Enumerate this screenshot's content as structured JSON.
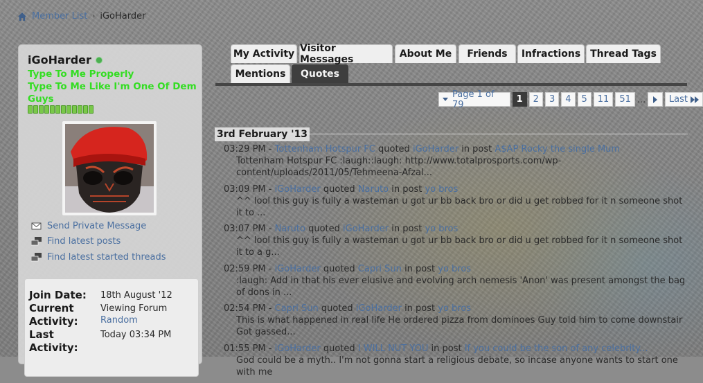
{
  "breadcrumb": {
    "items": [
      "Member List"
    ],
    "current": "iGoHarder"
  },
  "profile": {
    "username": "iGoHarder",
    "title_lines": [
      "Type To Me Properly",
      "Type To Me Like I'm One Of Dem Guys"
    ],
    "links": [
      "Send Private Message",
      "Find latest posts",
      "Find latest started threads"
    ],
    "info": {
      "join_label": "Join Date:",
      "join_value": "18th August '12",
      "current_label_1": "Current",
      "current_label_2": "Activity:",
      "current_value": "Viewing Forum",
      "current_link": "Random",
      "last_label_1": "Last",
      "last_label_2": "Activity:",
      "last_value": "Today 03:34 PM"
    }
  },
  "tabs": [
    "My Activity",
    "Visitor Messages",
    "About Me",
    "Friends",
    "Infractions",
    "Thread Tags",
    "Mentions",
    "Quotes"
  ],
  "active_tab": "Quotes",
  "pagination": {
    "page_of": "Page 1 of 79",
    "current": "1",
    "pages": [
      "2",
      "3",
      "4",
      "5",
      "11",
      "51"
    ],
    "dots": "...",
    "last": "Last"
  },
  "date_header": "3rd February '13",
  "activity": [
    {
      "time": "03:29 PM",
      "user": "Tottenham Hotspur FC",
      "verb": "quoted",
      "target": "iGoHarder",
      "in": "in post",
      "post": "A$AP Rocky the single Mum",
      "body": "Tottenham Hotspur FC :laugh::laugh: http://www.totalprosports.com/wp-content/uploads/2011/05/Tehmeena-Afzal..."
    },
    {
      "time": "03:09 PM",
      "user": "iGoHarder",
      "verb": "quoted",
      "target": "Naruto",
      "in": "in post",
      "post": "yo bros",
      "body": "^^ lool this guy is fully a wasteman u got ur bb back bro or did u get robbed for it n someone shot it to ..."
    },
    {
      "time": "03:07 PM",
      "user": "Naruto",
      "verb": "quoted",
      "target": "iGoHarder",
      "in": "in post",
      "post": "yo bros",
      "body": "^^ lool this guy is fully a wasteman u got ur bb back bro or did u get robbed for it n someone shot it to a g..."
    },
    {
      "time": "02:59 PM",
      "user": "iGoHarder",
      "verb": "quoted",
      "target": "Capri Sun",
      "in": "in post",
      "post": "yo bros",
      "body": ":laugh: Add in that his ever elusive and evolving arch nemesis 'Anon' was present amongst the bag of dons in ..."
    },
    {
      "time": "02:54 PM",
      "user": "Capri Sun",
      "verb": "quoted",
      "target": "iGoHarder",
      "in": "in post",
      "post": "yo bros",
      "body": "This is what happened in real life He ordered pizza from dominoes Guy told him to come downstair Got gassed..."
    },
    {
      "time": "01:55 PM",
      "user": "iGoHarder",
      "verb": "quoted",
      "target": "I WILL NUT YOU",
      "in": "in post",
      "post": "If you could be the son of any celebrity...",
      "body": "God could be a myth.. I'm not gonna start a religious debate, so incase anyone wants to start one with me"
    }
  ],
  "colors": {
    "link": "#4a6fa0",
    "usertitle": "#33dd22",
    "active_tab": "#3e3e3e"
  }
}
